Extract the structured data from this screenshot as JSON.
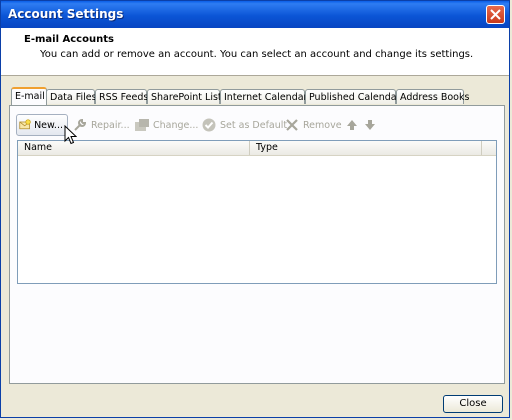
{
  "window": {
    "title": "Account Settings"
  },
  "header": {
    "title": "E-mail Accounts",
    "description": "You can add or remove an account. You can select an account and change its settings."
  },
  "tabs": [
    {
      "label": "E-mail",
      "active": true
    },
    {
      "label": "Data Files"
    },
    {
      "label": "RSS Feeds"
    },
    {
      "label": "SharePoint Lists"
    },
    {
      "label": "Internet Calendars"
    },
    {
      "label": "Published Calendars"
    },
    {
      "label": "Address Books"
    }
  ],
  "toolbar": {
    "new_label": "New...",
    "repair_label": "Repair...",
    "change_label": "Change...",
    "default_label": "Set as Default",
    "remove_label": "Remove"
  },
  "list": {
    "columns": [
      "Name",
      "Type"
    ],
    "rows": []
  },
  "footer": {
    "close_label": "Close"
  },
  "colors": {
    "titlebar": "#0a5fe8",
    "accent_tab": "#f0a030"
  }
}
